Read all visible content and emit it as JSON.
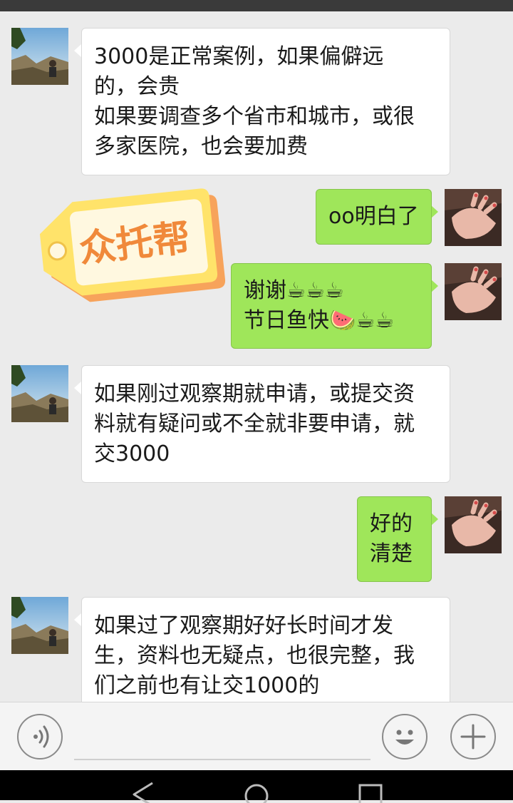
{
  "messages": [
    {
      "side": "left",
      "lines": [
        "3000是正常案例，如果偏僻远",
        "的，会贵",
        "如果要调查多个省市和城市，或很",
        "多家医院，也会要加费"
      ]
    },
    {
      "side": "right",
      "lines": [
        "oo明白了"
      ]
    },
    {
      "side": "right",
      "lines": [
        "谢谢☕☕☕",
        "节日鱼快🍉☕☕"
      ]
    },
    {
      "side": "left",
      "lines": [
        "如果刚过观察期就申请，或提交资",
        "料就有疑问或不全就非要申请，就",
        "交3000"
      ]
    },
    {
      "side": "right",
      "lines": [
        "好的",
        "清楚"
      ]
    },
    {
      "side": "left",
      "lines": [
        "如果过了观察期好好长时间才发",
        "生，资料也无疑点，也很完整，我",
        "们之前也有让交1000的"
      ]
    }
  ],
  "sticker": {
    "text": "众托帮"
  },
  "icons": {
    "voice": "voice-input-icon",
    "emoji": "emoji-icon",
    "plus": "plus-icon",
    "back": "back-triangle-icon",
    "home": "home-circle-icon",
    "recents": "recents-square-icon"
  },
  "colors": {
    "sent_bubble": "#9fe65a",
    "received_bubble": "#ffffff",
    "background": "#ebebeb",
    "sticker_text": "#f0893a"
  }
}
